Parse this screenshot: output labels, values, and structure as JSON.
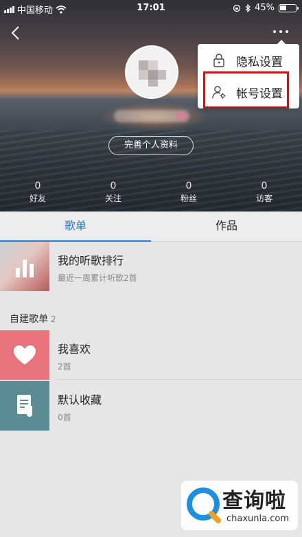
{
  "status_bar": {
    "carrier": "中国移动",
    "time": "17:01",
    "battery": "45%",
    "battery_level": 0.45
  },
  "profile": {
    "complete_profile_label": "完善个人资料",
    "stats": [
      {
        "value": "0",
        "label": "好友"
      },
      {
        "value": "0",
        "label": "关注"
      },
      {
        "value": "0",
        "label": "粉丝"
      },
      {
        "value": "0",
        "label": "访客"
      }
    ]
  },
  "popup_menu": {
    "items": [
      {
        "label": "隐私设置",
        "icon": "lock-icon"
      },
      {
        "label": "帐号设置",
        "icon": "user-settings-icon"
      }
    ],
    "highlight_color": "#c0181c"
  },
  "tabs": [
    {
      "label": "歌单",
      "active": true
    },
    {
      "label": "作品",
      "active": false
    }
  ],
  "ranking": {
    "title": "我的听歌排行",
    "subtitle": "最近一周累计听歌2首"
  },
  "custom_playlists": {
    "header": "自建歌单",
    "count": "2",
    "items": [
      {
        "title": "我喜欢",
        "subtitle": "2首",
        "icon": "heart-icon",
        "color": "#e8737c"
      },
      {
        "title": "默认收藏",
        "subtitle": "0首",
        "icon": "music-note-icon",
        "color": "#5c8c94"
      }
    ]
  },
  "watermark": {
    "title": "查询啦",
    "url": "chaxunla.com"
  },
  "colors": {
    "accent": "#2b7bd0"
  }
}
